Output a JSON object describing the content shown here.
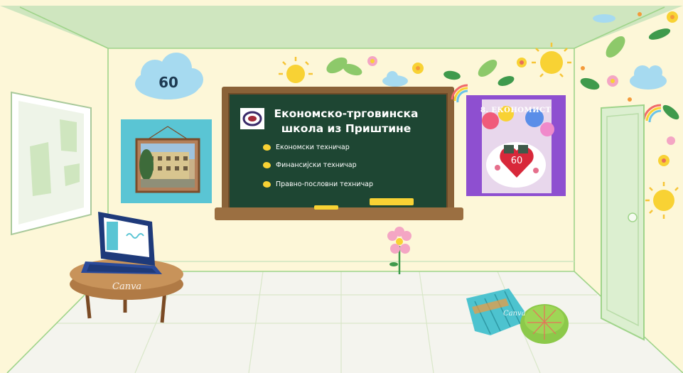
{
  "board": {
    "title_line1": "Економско-трговинска",
    "title_line2": "школа из Приштине",
    "items": [
      {
        "label": "Економски техничар"
      },
      {
        "label": "Финансијски техничар"
      },
      {
        "label": "Правно-пословни техничар"
      }
    ]
  },
  "cloud": {
    "number": "60"
  },
  "poster": {
    "title": "8. ЕКОНОМИСТ",
    "cake_number": "60"
  },
  "watermarks": {
    "table": "Canva",
    "pillow": "Canva"
  },
  "colors": {
    "wall": "#fdf7d8",
    "ceiling": "#cfe6bf",
    "floor": "#f4f4ee",
    "chalkboard": "#1e4633",
    "board_frame": "#8a6238",
    "poster_border": "#8e4fd0",
    "door": "#dcefd0",
    "cloud": "#a6daf0",
    "accent_yellow": "#f8d234"
  },
  "icons": [
    "cloud-icon",
    "sun-icon",
    "leaf-icon",
    "flower-icon",
    "rainbow-icon",
    "laptop-icon",
    "heart-icon",
    "school-logo-icon"
  ]
}
